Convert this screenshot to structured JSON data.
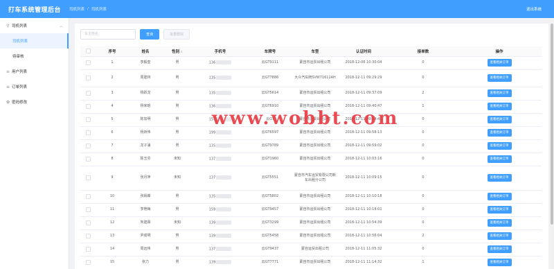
{
  "header": {
    "title": "打车系统管理后台",
    "crumb1": "司机列表",
    "sep": "/",
    "crumb2": "司机列表",
    "logout": "退出系统"
  },
  "sidebar": {
    "group1": "司机列表",
    "sub1": "司机列表",
    "sub2": "待审核",
    "group2": "用户列表",
    "group3": "订单列表",
    "group4": "密码修改"
  },
  "toolbar": {
    "search_placeholder": "车主姓名",
    "search_label": "查询",
    "delete_label": "批量删除"
  },
  "table": {
    "headers": [
      "序号",
      "姓名",
      "性别",
      "手机号",
      "车牌号",
      "车型",
      "认证时间",
      "接单数",
      "操作"
    ],
    "action_label": "查看相关订单",
    "rows": [
      {
        "no": "1",
        "name": "李毅奎",
        "sex": "男",
        "phone": "136",
        "plate": "云GT9111",
        "model": "蒙自市运贸出租公司",
        "time": "2018-12-06 10:30:04",
        "orders": "0"
      },
      {
        "no": "2",
        "name": "周建林",
        "sex": "男",
        "phone": "135",
        "plate": "云GT7886",
        "model": "大众汽车牌SVW71612AH",
        "time": "2018-12-11 09:29:29",
        "orders": "0"
      },
      {
        "no": "3",
        "name": "杨跃龙",
        "sex": "男",
        "phone": "135",
        "plate": "云GT5614",
        "model": "蒙自市运贸出租公司",
        "time": "2018-12-11 09:37:09",
        "orders": "2"
      },
      {
        "no": "4",
        "name": "杨家琨",
        "sex": "男",
        "phone": "136",
        "plate": "云GT6910",
        "model": "蒙自市运贸出租公司",
        "time": "2018-12-11 09:40:47",
        "orders": "1"
      },
      {
        "no": "5",
        "name": "陈加明",
        "sex": "男",
        "phone": "157",
        "plate": "云GT",
        "model": "蒙自市运贸出租公司",
        "time": "2018-12-11 09:54:41",
        "orders": "0"
      },
      {
        "no": "6",
        "name": "杨娇伟",
        "sex": "男",
        "phone": "199",
        "plate": "云GT6597",
        "model": "蒙自市运贸出租公司",
        "time": "2018-12-11 09:58:13",
        "orders": "0"
      },
      {
        "no": "7",
        "name": "龙子涌",
        "sex": "男",
        "phone": "135",
        "plate": "云GT9789",
        "model": "蒙自市运贸出租公司",
        "time": "2018-12-11 09:59:02",
        "orders": "0"
      },
      {
        "no": "8",
        "name": "陈玉芬",
        "sex": "未知",
        "phone": "137",
        "plate": "云GT1960",
        "model": "蒙自市运贸出租公司",
        "time": "2018-12-11 10:03:16",
        "orders": "0"
      },
      {
        "no": "9",
        "name": "张月萍",
        "sex": "未知",
        "phone": "137",
        "plate": "云GT5551",
        "model": "蒙自市汽车运贸有限公司新车出租分公司",
        "time": "2018-12-11 10:09:15",
        "orders": "0"
      },
      {
        "no": "10",
        "name": "张嫣蝶",
        "sex": "男",
        "phone": "135",
        "plate": "云GT5802",
        "model": "蒙自市运贸出租公司",
        "time": "2018-12-11 10:10:18",
        "orders": "0"
      },
      {
        "no": "11",
        "name": "李艳梅",
        "sex": "男",
        "phone": "159",
        "plate": "云GT9457",
        "model": "蒙自市运贸出租公司",
        "time": "2018-12-11 10:18:01",
        "orders": "0"
      },
      {
        "no": "12",
        "name": "朱建霖",
        "sex": "未知",
        "phone": "139",
        "plate": "云GT3299",
        "model": "蒙自市运贸出租公司",
        "time": "2018-12-11 10:54:39",
        "orders": "0"
      },
      {
        "no": "13",
        "name": "尹成明",
        "sex": "男",
        "phone": "139",
        "plate": "云GT5458",
        "model": "蒙自市运贸出租公司",
        "time": "2018-12-11 10:56:04",
        "orders": "2"
      },
      {
        "no": "14",
        "name": "周远伟",
        "sex": "男",
        "phone": "137",
        "plate": "云GT9437",
        "model": "蒙自运贸出租公司",
        "time": "2018-12-11 11:05:32",
        "orders": "0"
      },
      {
        "no": "15",
        "name": "张力",
        "sex": "男",
        "phone": "139",
        "plate": "云GT7771",
        "model": "蒙自市运贸出租公司",
        "time": "2018-12-11 11:14:32",
        "orders": "1"
      }
    ]
  },
  "watermark": "www.wobbt.com",
  "colors": {
    "accent": "#409eff",
    "watermark": "#e8373f"
  }
}
